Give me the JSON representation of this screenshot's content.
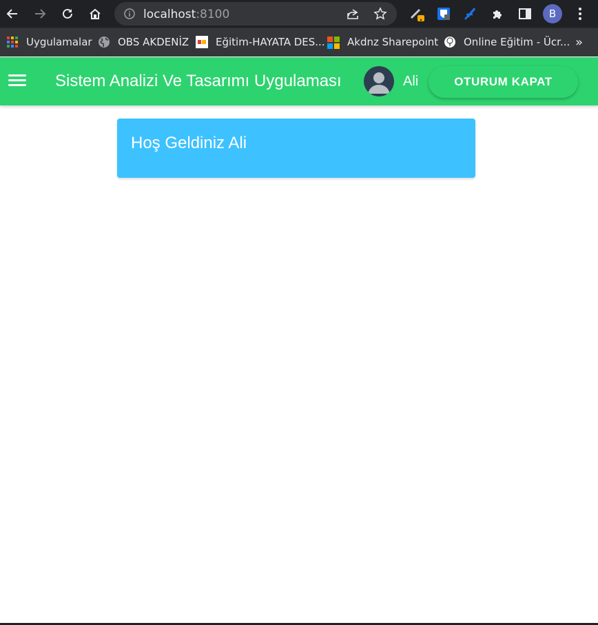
{
  "browser": {
    "address_host": "localhost",
    "address_port": ":8100",
    "bookmarks": [
      {
        "label": "Uygulamalar",
        "icon": "apps-grid-icon"
      },
      {
        "label": "OBS AKDENİZ",
        "icon": "globe-icon"
      },
      {
        "label": "Eğitim-HAYATA DES...",
        "icon": "site-logo-icon"
      },
      {
        "label": "Akdnz Sharepoint",
        "icon": "microsoft-icon"
      },
      {
        "label": "Online Eğitim - Ücr...",
        "icon": "tree-icon"
      }
    ],
    "more_bookmarks": "»",
    "profile_initial": "B"
  },
  "toolbar": {
    "title": "Sistem Analizi Ve Tasarımı Uygulaması",
    "user_name": "Ali",
    "logout_label": "OTURUM KAPAT",
    "color": "#2dd36f"
  },
  "content": {
    "welcome": "Hoş Geldiniz Ali",
    "card_color": "#3dc2ff"
  }
}
